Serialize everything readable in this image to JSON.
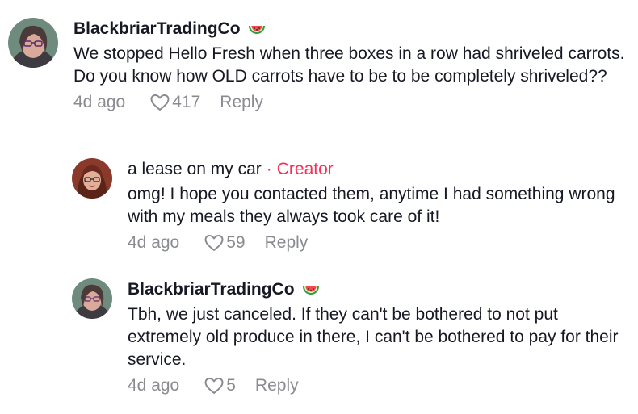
{
  "comments": [
    {
      "username": "BlackbriarTradingCo",
      "badge_icon": "watermelon-icon",
      "text": "We stopped Hello Fresh when three boxes in a row had shriveled carrots. Do you know how OLD carrots have to be to be completely shriveled??",
      "date": "4d ago",
      "likes": "417",
      "reply_label": "Reply"
    },
    {
      "username": "a lease on my car",
      "separator": "·",
      "creator_label": "Creator",
      "text": "omg! I hope you contacted them, anytime I had something wrong with my meals they always took care of it!",
      "date": "4d ago",
      "likes": "59",
      "reply_label": "Reply"
    },
    {
      "username": "BlackbriarTradingCo",
      "badge_icon": "watermelon-icon",
      "text": "Tbh, we just canceled. If they can't be bothered to not put extremely old produce in there, I can't be bothered to pay for their service.",
      "date": "4d ago",
      "likes": "5",
      "reply_label": "Reply"
    }
  ],
  "colors": {
    "text": "#161823",
    "meta": "#8a8b91",
    "creator": "#fe2c55"
  }
}
